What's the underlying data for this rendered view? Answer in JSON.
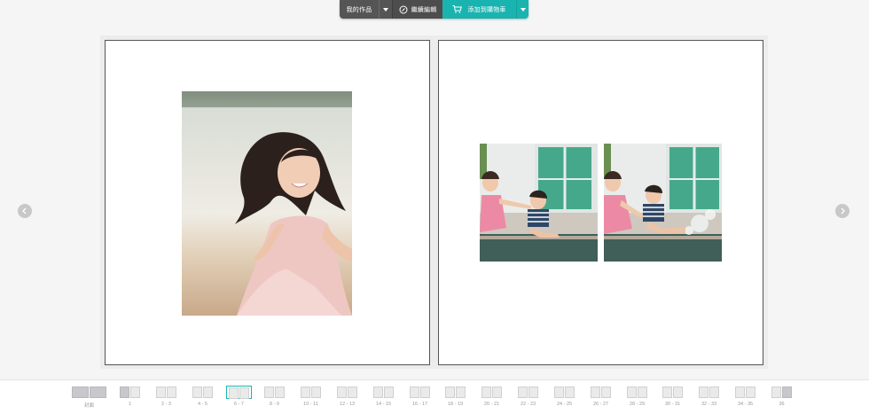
{
  "toolbar": {
    "my_works_label": "我的作品",
    "continue_edit_label": "繼續編輯",
    "add_to_cart_label": "添加到購物車",
    "cart_color": "#19b4b0",
    "dark_color": "#555555",
    "icons": [
      "chevron-down-icon",
      "edit-icon",
      "cart-icon"
    ]
  },
  "spread": {
    "left_page": {
      "photos": [
        "girl-portrait-photo"
      ]
    },
    "right_page": {
      "photos": [
        "kids-by-pool-photo-1",
        "kids-by-pool-photo-2"
      ]
    }
  },
  "navigation": {
    "prev_icon": "chevron-left-icon",
    "next_icon": "chevron-right-icon"
  },
  "thumbnails": [
    {
      "label": "封面"
    },
    {
      "label": "1"
    },
    {
      "label": "2 - 3"
    },
    {
      "label": "4 - 5"
    },
    {
      "label": "6 - 7"
    },
    {
      "label": "8 - 9"
    },
    {
      "label": "10 - 11"
    },
    {
      "label": "12 - 13"
    },
    {
      "label": "14 - 15"
    },
    {
      "label": "16 - 17"
    },
    {
      "label": "18 - 19"
    },
    {
      "label": "20 - 21"
    },
    {
      "label": "22 - 23"
    },
    {
      "label": "24 - 25"
    },
    {
      "label": "26 - 27"
    },
    {
      "label": "28 - 29"
    },
    {
      "label": "30 - 31"
    },
    {
      "label": "32 - 33"
    },
    {
      "label": "34 - 35"
    },
    {
      "label": "36"
    }
  ]
}
